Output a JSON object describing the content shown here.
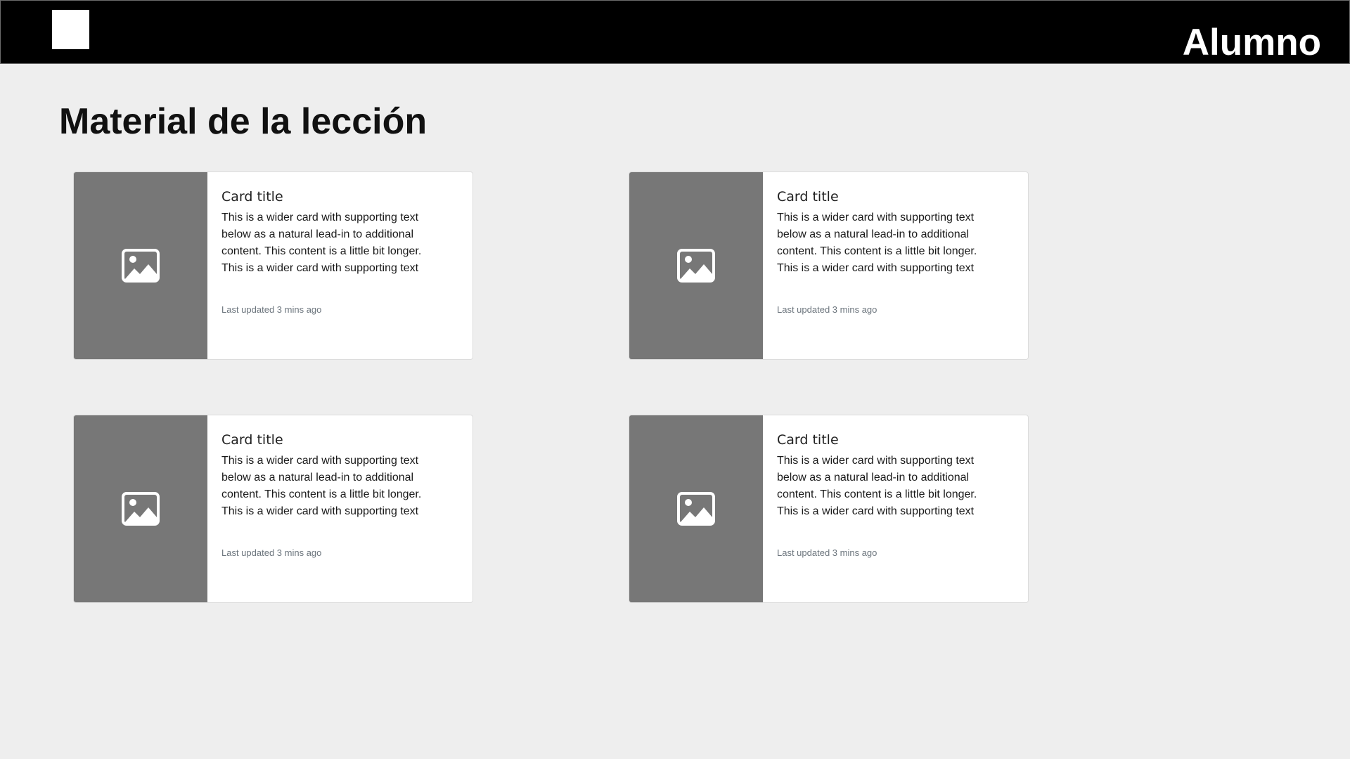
{
  "header": {
    "user_label": "Alumno"
  },
  "page": {
    "title": "Material de la lección"
  },
  "cards": [
    {
      "title": "Card title",
      "text": "This is a wider card with supporting text below as a natural lead-in to additional content. This content is a little bit longer. This is a wider card with supporting text",
      "meta": "Last updated 3 mins ago",
      "image_icon": "image-icon"
    },
    {
      "title": "Card title",
      "text": "This is a wider card with supporting text below as a natural lead-in to additional content. This content is a little bit longer. This is a wider card with supporting text",
      "meta": "Last updated 3 mins ago",
      "image_icon": "image-icon"
    },
    {
      "title": "Card title",
      "text": "This is a wider card with supporting text below as a natural lead-in to additional content. This content is a little bit longer. This is a wider card with supporting text",
      "meta": "Last updated 3 mins ago",
      "image_icon": "image-icon"
    },
    {
      "title": "Card title",
      "text": "This is a wider card with supporting text below as a natural lead-in to additional content. This content is a little bit longer. This is a wider card with supporting text",
      "meta": "Last updated 3 mins ago",
      "image_icon": "image-icon"
    }
  ],
  "colors": {
    "topbar": "#000000",
    "background": "#eeeeee",
    "card_image": "#777777",
    "meta_text": "#6c757d"
  }
}
